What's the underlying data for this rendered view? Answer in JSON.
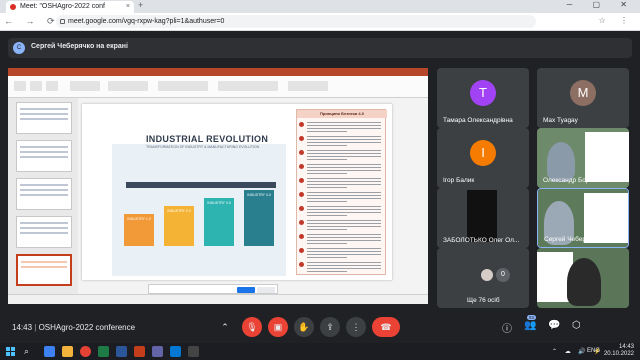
{
  "browser": {
    "tab_title": "Meet: \"OSHAgro-2022 conf",
    "tab_close": "×",
    "new_tab": "+",
    "url": "meet.google.com/vgq-rxpw-kag?pli=1&authuser=0",
    "nav_icons": "← → ⟳",
    "window_controls": "─ ▢ ✕",
    "right_icons": "☆ ⋮"
  },
  "meet": {
    "presenter_label": "Сергей Чеберячко на екрані",
    "presenter_initial": "С",
    "time": "14:43",
    "meeting_name": "OSHAgro-2022 conference",
    "more_count": "0",
    "more_label": "Ще 76 осіб",
    "people_count": "83",
    "participants": [
      {
        "name": "Тамара Олександрівна",
        "initial": "Т",
        "color": "#a142f4"
      },
      {
        "name": "Max Tyagay",
        "initial": "M",
        "color": "#8d6e63"
      },
      {
        "name": "Ігор Балик",
        "initial": "І",
        "color": "#f57c00"
      },
      {
        "name": "Олександр Боровик",
        "initial": "",
        "color": ""
      },
      {
        "name": "ЗАБОЛОТЬКО Олег Ол...",
        "initial": "",
        "color": ""
      },
      {
        "name": "Сергей Чеберячко",
        "initial": "",
        "color": ""
      }
    ],
    "control_icons": {
      "more": "⌃",
      "mic": "🎙",
      "camera": "▣",
      "hand": "✋",
      "present": "⇪",
      "options": "⋮",
      "end": "☎",
      "info": "ⓘ",
      "people": "👥",
      "chat": "💬",
      "activities": "⬡",
      "tile_options": "⋮"
    }
  },
  "slide": {
    "title": "INDUSTRIAL REVOLUTION",
    "subtitle": "TRANSFORMATION OF INDUSTRY & MANUFACTURING EVOLUTION",
    "steps": [
      "INDUSTRY 1.0",
      "INDUSTRY 2.0",
      "INDUSTRY 3.0",
      "INDUSTRY 4.0"
    ],
    "principles_title": "Принципи Безпеки 4.0"
  },
  "taskbar": {
    "search_icon": "⌕",
    "tray_icons": "⌃ ☁ 🔊 ⚡",
    "language": "ENG",
    "time": "14:43",
    "date": "20.10.2022"
  }
}
